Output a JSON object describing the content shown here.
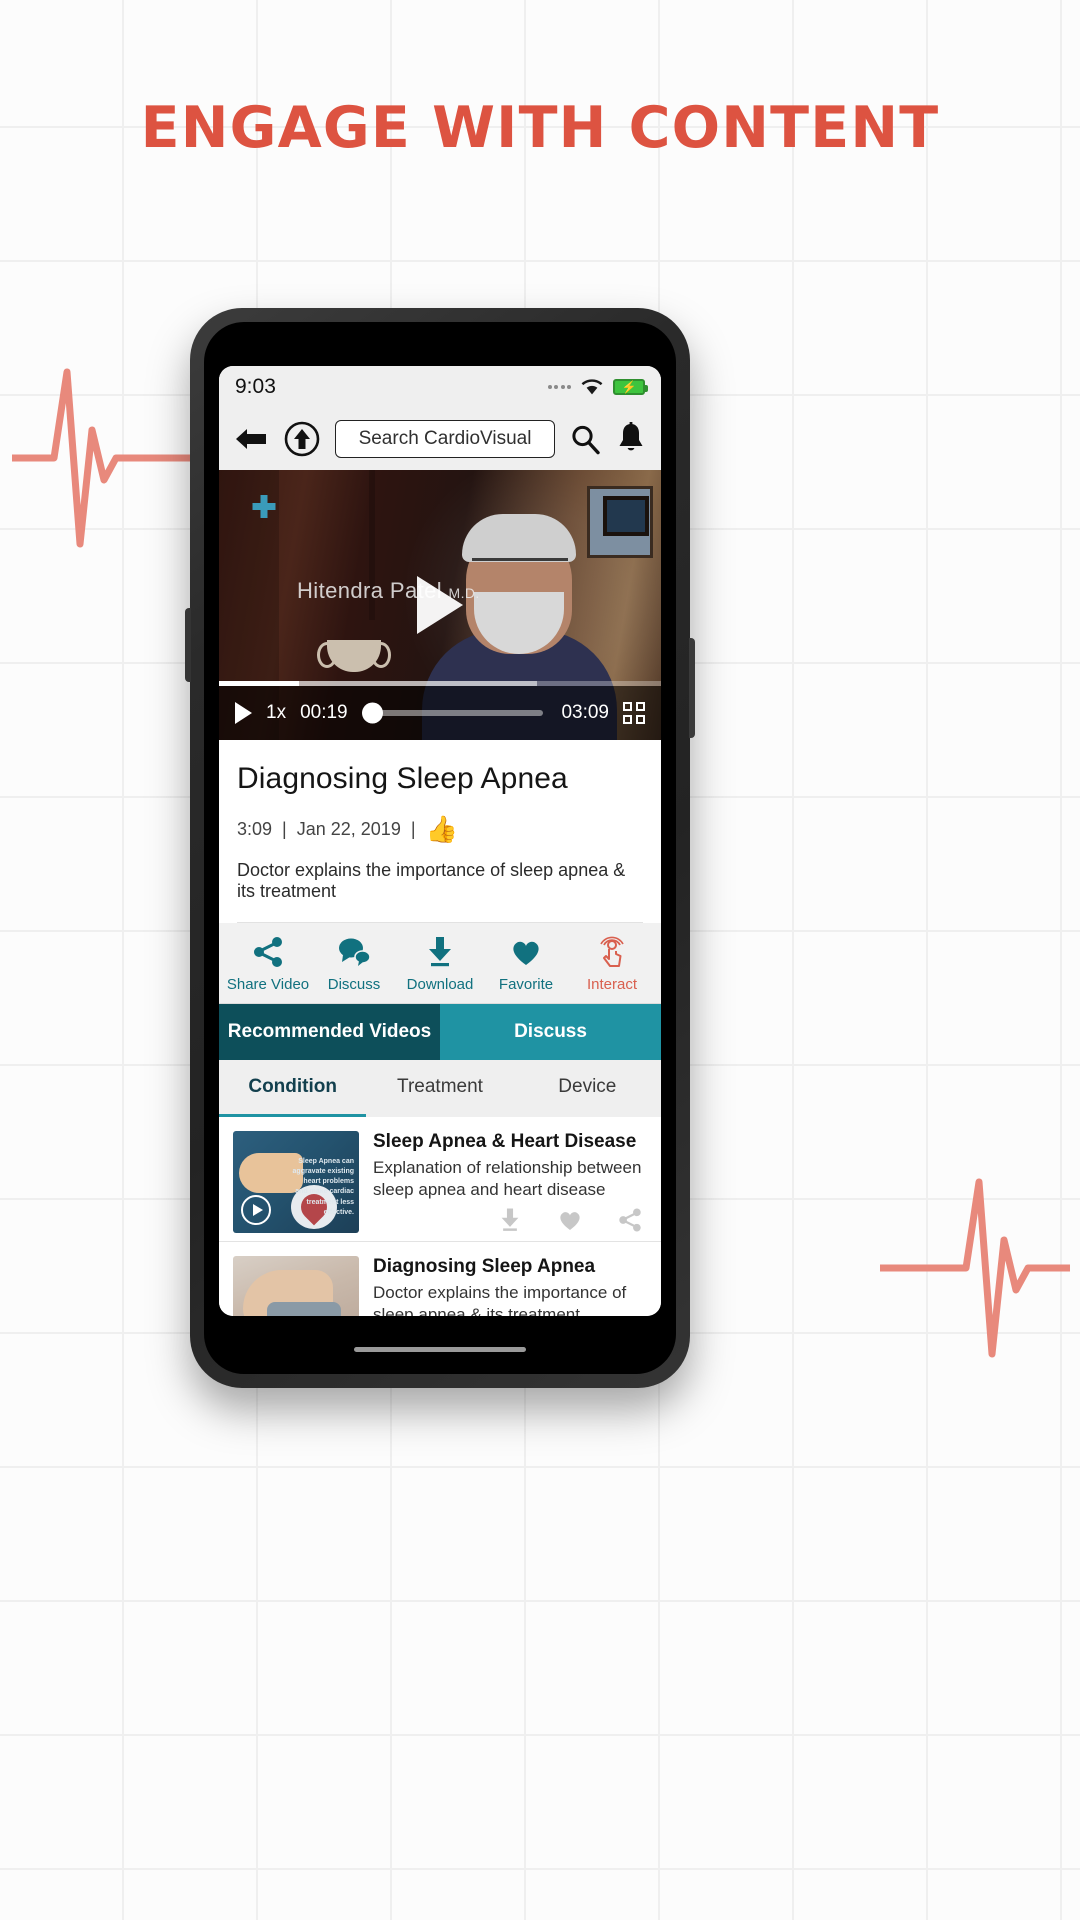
{
  "poster": {
    "headline": "ENGAGE WITH CONTENT",
    "accent_color": "#dd5341",
    "background_color": "#fcfcfc",
    "grid_line_color": "#efefef"
  },
  "phone": {
    "status_bar": {
      "time": "9:03",
      "signal_icon": "signal-dots-icon",
      "wifi_icon": "wifi-icon",
      "battery_icon": "battery-charging-icon"
    },
    "nav_bar": {
      "back_icon": "back-arrow-icon",
      "up_icon": "up-arrow-circle-icon",
      "search_placeholder": "Search CardioVisual",
      "search_icon": "search-icon",
      "bell_icon": "bell-icon"
    },
    "player": {
      "speaker_name": "Hitendra Patel",
      "speaker_credential": "M.D.",
      "logo_icon": "cardiovisual-cross-logo-icon",
      "big_play_icon": "play-icon",
      "play_icon": "play-icon",
      "speed": "1x",
      "current_time": "00:19",
      "duration": "03:09",
      "fullscreen_icon": "fullscreen-icon"
    },
    "video_info": {
      "title": "Diagnosing Sleep Apnea",
      "length": "3:09",
      "separator": "|",
      "date": "Jan 22, 2019",
      "like_icon": "thumbs-up-icon",
      "description": "Doctor explains the importance of sleep apnea & its treatment"
    },
    "actions": [
      {
        "label": "Share Video",
        "icon": "share-icon",
        "color": "#11717f"
      },
      {
        "label": "Discuss",
        "icon": "chat-bubbles-icon",
        "color": "#11717f"
      },
      {
        "label": "Download",
        "icon": "download-icon",
        "color": "#11717f"
      },
      {
        "label": "Favorite",
        "icon": "heart-icon",
        "color": "#11717f"
      },
      {
        "label": "Interact",
        "icon": "interact-tap-icon",
        "color": "#d9604f"
      }
    ],
    "tabs": [
      {
        "label": "Recommended Videos",
        "active": true
      },
      {
        "label": "Discuss",
        "active": false
      }
    ],
    "subtabs": [
      {
        "label": "Condition",
        "active": true
      },
      {
        "label": "Treatment",
        "active": false
      },
      {
        "label": "Device",
        "active": false
      }
    ],
    "recommended": [
      {
        "title": "Sleep Apnea & Heart Disease",
        "description": "Explanation of relationship between sleep apnea and heart disease",
        "thumb_caption": "Sleep Apnea can aggravate existing heart problems and make cardiac treatment less effective.",
        "play_icon": "play-circle-icon",
        "row_actions": [
          "download-icon",
          "heart-icon",
          "share-icon"
        ]
      },
      {
        "title": "Diagnosing Sleep Apnea",
        "description": "Doctor explains the importance of sleep apnea & its treatment",
        "thumb_caption": "",
        "play_icon": "play-circle-icon",
        "row_actions": [
          "download-icon",
          "heart-icon",
          "share-icon"
        ]
      }
    ]
  }
}
